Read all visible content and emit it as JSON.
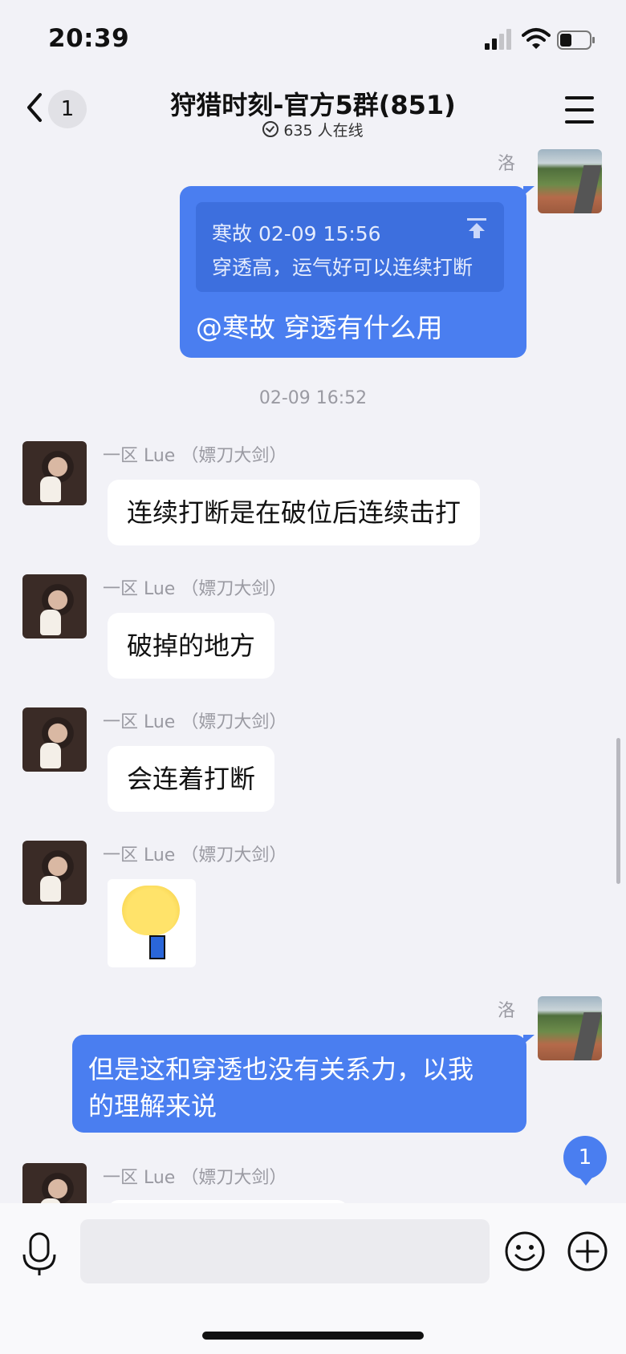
{
  "status_bar": {
    "time": "20:39"
  },
  "header": {
    "back_badge": "1",
    "title": "狩猎时刻-官方5群(851)",
    "online": "635 人在线"
  },
  "messages": {
    "m1": {
      "sender": "洛",
      "quote_meta": "寒故 02-09 15:56",
      "quote_text": "穿透高，运气好可以连续打断",
      "text": "@寒故 穿透有什么用"
    },
    "timestamp": "02-09 16:52",
    "m2": {
      "sender": "一区 Lue （嫖刀大剑）",
      "text": "连续打断是在破位后连续击打"
    },
    "m3": {
      "sender": "一区 Lue （嫖刀大剑）",
      "text": "破掉的地方"
    },
    "m4": {
      "sender": "一区 Lue （嫖刀大剑）",
      "text": "会连着打断"
    },
    "m5": {
      "sender": "一区 Lue （嫖刀大剑）"
    },
    "m6": {
      "sender": "洛",
      "line1": "但是这和穿透也没有关系力，以我",
      "line2": "的理解来说"
    },
    "m7": {
      "sender": "一区 Lue （嫖刀大剑）"
    }
  },
  "new_messages_badge": "1",
  "input": {
    "value": "",
    "placeholder": ""
  },
  "colors": {
    "accent": "#4a7ef0",
    "background": "#f2f2f7"
  },
  "icons": [
    "back-icon",
    "signal-icon",
    "wifi-icon",
    "battery-icon",
    "menu-icon",
    "pin-top-icon",
    "mic-icon",
    "emoji-icon",
    "plus-icon"
  ]
}
